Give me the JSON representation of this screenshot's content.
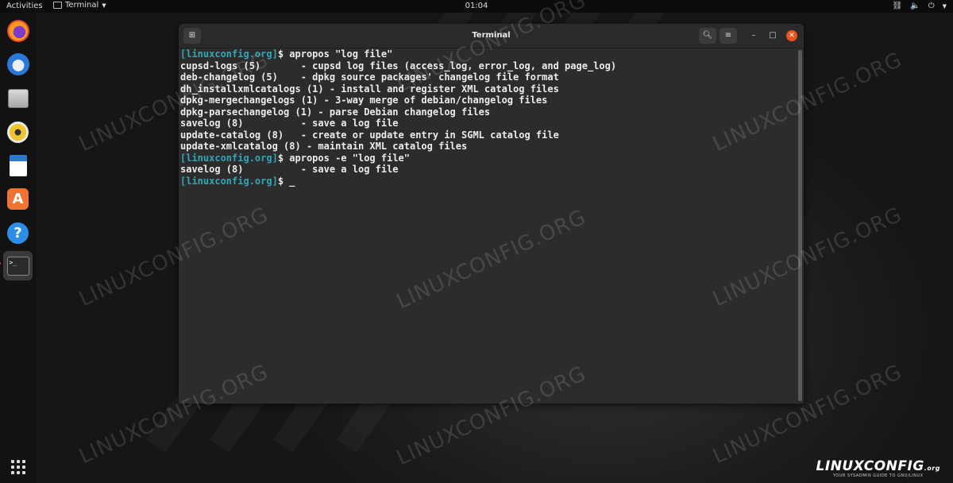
{
  "topbar": {
    "activities": "Activities",
    "app_name": "Terminal",
    "clock": "01:04",
    "tray_icons": [
      "network-icon",
      "volume-icon",
      "power-icon",
      "chevron-down-icon"
    ]
  },
  "dock": {
    "items": [
      "firefox",
      "thunderbird",
      "files",
      "rhythmbox",
      "libreoffice-writer",
      "software-center",
      "help",
      "terminal"
    ],
    "active": "terminal",
    "show_apps_icon": "apps-grid-icon",
    "store_glyph": "A",
    "help_glyph": "?",
    "terminal_glyph": ">_"
  },
  "terminal": {
    "title": "Terminal",
    "lines": [
      {
        "prompt": "[linuxconfig.org]",
        "text": "$ apropos \"log file\""
      },
      {
        "prompt": "",
        "text": "cupsd-logs (5)       - cupsd log files (access_log, error_log, and page_log)"
      },
      {
        "prompt": "",
        "text": "deb-changelog (5)    - dpkg source packages' changelog file format"
      },
      {
        "prompt": "",
        "text": "dh_installxmlcatalogs (1) - install and register XML catalog files"
      },
      {
        "prompt": "",
        "text": "dpkg-mergechangelogs (1) - 3-way merge of debian/changelog files"
      },
      {
        "prompt": "",
        "text": "dpkg-parsechangelog (1) - parse Debian changelog files"
      },
      {
        "prompt": "",
        "text": "savelog (8)          - save a log file"
      },
      {
        "prompt": "",
        "text": "update-catalog (8)   - create or update entry in SGML catalog file"
      },
      {
        "prompt": "",
        "text": "update-xmlcatalog (8) - maintain XML catalog files"
      },
      {
        "prompt": "[linuxconfig.org]",
        "text": "$ apropos -e \"log file\""
      },
      {
        "prompt": "",
        "text": "savelog (8)          - save a log file"
      },
      {
        "prompt": "[linuxconfig.org]",
        "text": "$ _"
      }
    ]
  },
  "watermark_text": "LINUXCONFIG.ORG",
  "logo": {
    "brand": "LINUXCONFIG",
    "suffix": ".org",
    "tagline": "YOUR SYSADMIN GUIDE TO GNU/LINUX"
  },
  "colors": {
    "prompt": "#2fa7b8",
    "close": "#e9541f"
  }
}
